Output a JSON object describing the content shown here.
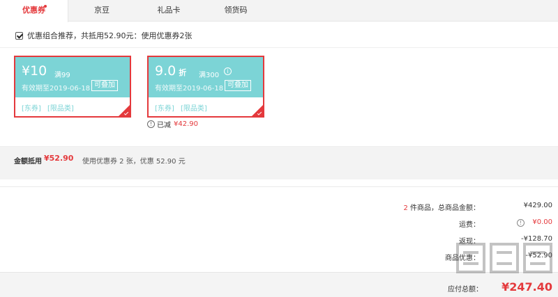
{
  "tabs": [
    {
      "label": "优惠券",
      "active": true
    },
    {
      "label": "京豆",
      "active": false
    },
    {
      "label": "礼品卡",
      "active": false
    },
    {
      "label": "领货码",
      "active": false
    }
  ],
  "combo": {
    "checked": true,
    "text": "优惠组合推荐，共抵用52.90元：使用优惠券2张"
  },
  "coupons": [
    {
      "amount": "¥10",
      "unit": "",
      "condition": "满99",
      "validity": "有效期至2019-06-18",
      "stackable": "可叠加",
      "tags": [
        "[东券]",
        "[限品类]"
      ]
    },
    {
      "amount": "9.0",
      "unit": "折",
      "condition": "满300",
      "validity": "有效期至2019-06-18",
      "stackable": "可叠加",
      "tags": [
        "[东券]",
        "[限品类]"
      ]
    }
  ],
  "reduced": {
    "label": "已减",
    "value": "¥42.90"
  },
  "summary": {
    "label": "金额抵用",
    "amount": "¥52.90",
    "desc": "使用优惠券 2 张，优惠 52.90 元"
  },
  "totals": {
    "count": "2",
    "count_suffix": " 件商品，总商品金额：",
    "goods_amount": "¥429.00",
    "shipping_label": "运费：",
    "shipping_value": "¥0.00",
    "cashback_label": "返现：",
    "cashback_value": "-¥128.70",
    "discount_label": "商品优惠：",
    "discount_value": "-¥52.90",
    "payable_label": "应付总额：",
    "payable_value": "¥247.40"
  },
  "colors": {
    "accent": "#e4393c",
    "coupon_teal": "#7cd4d6"
  }
}
